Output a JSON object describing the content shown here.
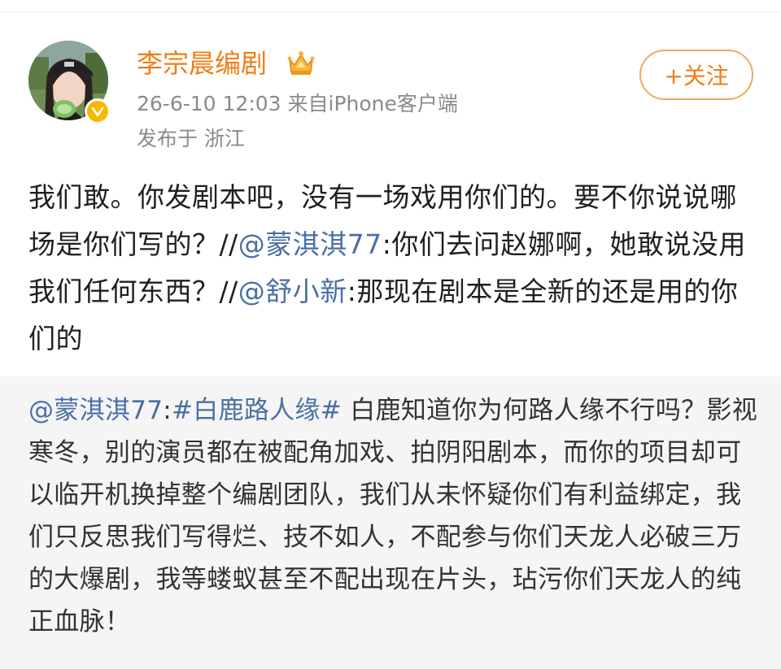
{
  "author": {
    "name": "李宗晨编剧",
    "meta": "26-6-10 12:03  来自iPhone客户端",
    "location": "发布于 浙江",
    "badge": "V"
  },
  "follow_button": {
    "label": "+关注"
  },
  "post": {
    "segments": [
      {
        "type": "text",
        "text": "我们敢。你发剧本吧，没有一场戏用你们的。要不你说说哪场是你们写的？//"
      },
      {
        "type": "mention",
        "text": "@蒙淇淇77"
      },
      {
        "type": "text",
        "text": ":你们去问赵娜啊，她敢说没用我们任何东西？//"
      },
      {
        "type": "mention",
        "text": "@舒小新"
      },
      {
        "type": "text",
        "text": ":那现在剧本是全新的还是用的你们的"
      }
    ]
  },
  "repost": {
    "segments": [
      {
        "type": "mention",
        "text": "@蒙淇淇77"
      },
      {
        "type": "text",
        "text": ":"
      },
      {
        "type": "hashtag",
        "text": "#白鹿路人缘#"
      },
      {
        "type": "text",
        "text": " 白鹿知道你为何路人缘不行吗？影视寒冬，别的演员都在被配角加戏、拍阴阳剧本，而你的项目却可以临开机换掉整个编剧团队，我们从未怀疑你们有利益绑定，我们只反思我们写得烂、技不如人，不配参与你们天龙人必破三万的大爆剧，我等蝼蚁甚至不配出现在片头，玷污你们天龙人的纯正血脉！"
      }
    ]
  },
  "colors": {
    "username": "#f07d13",
    "link": "#4a6fa5",
    "meta": "#8a8a8a",
    "repost_bg": "#f5f5f5"
  },
  "icons": {
    "avatar": "avatar-photo",
    "verified": "verified-badge-icon",
    "crown": "crown-icon"
  }
}
